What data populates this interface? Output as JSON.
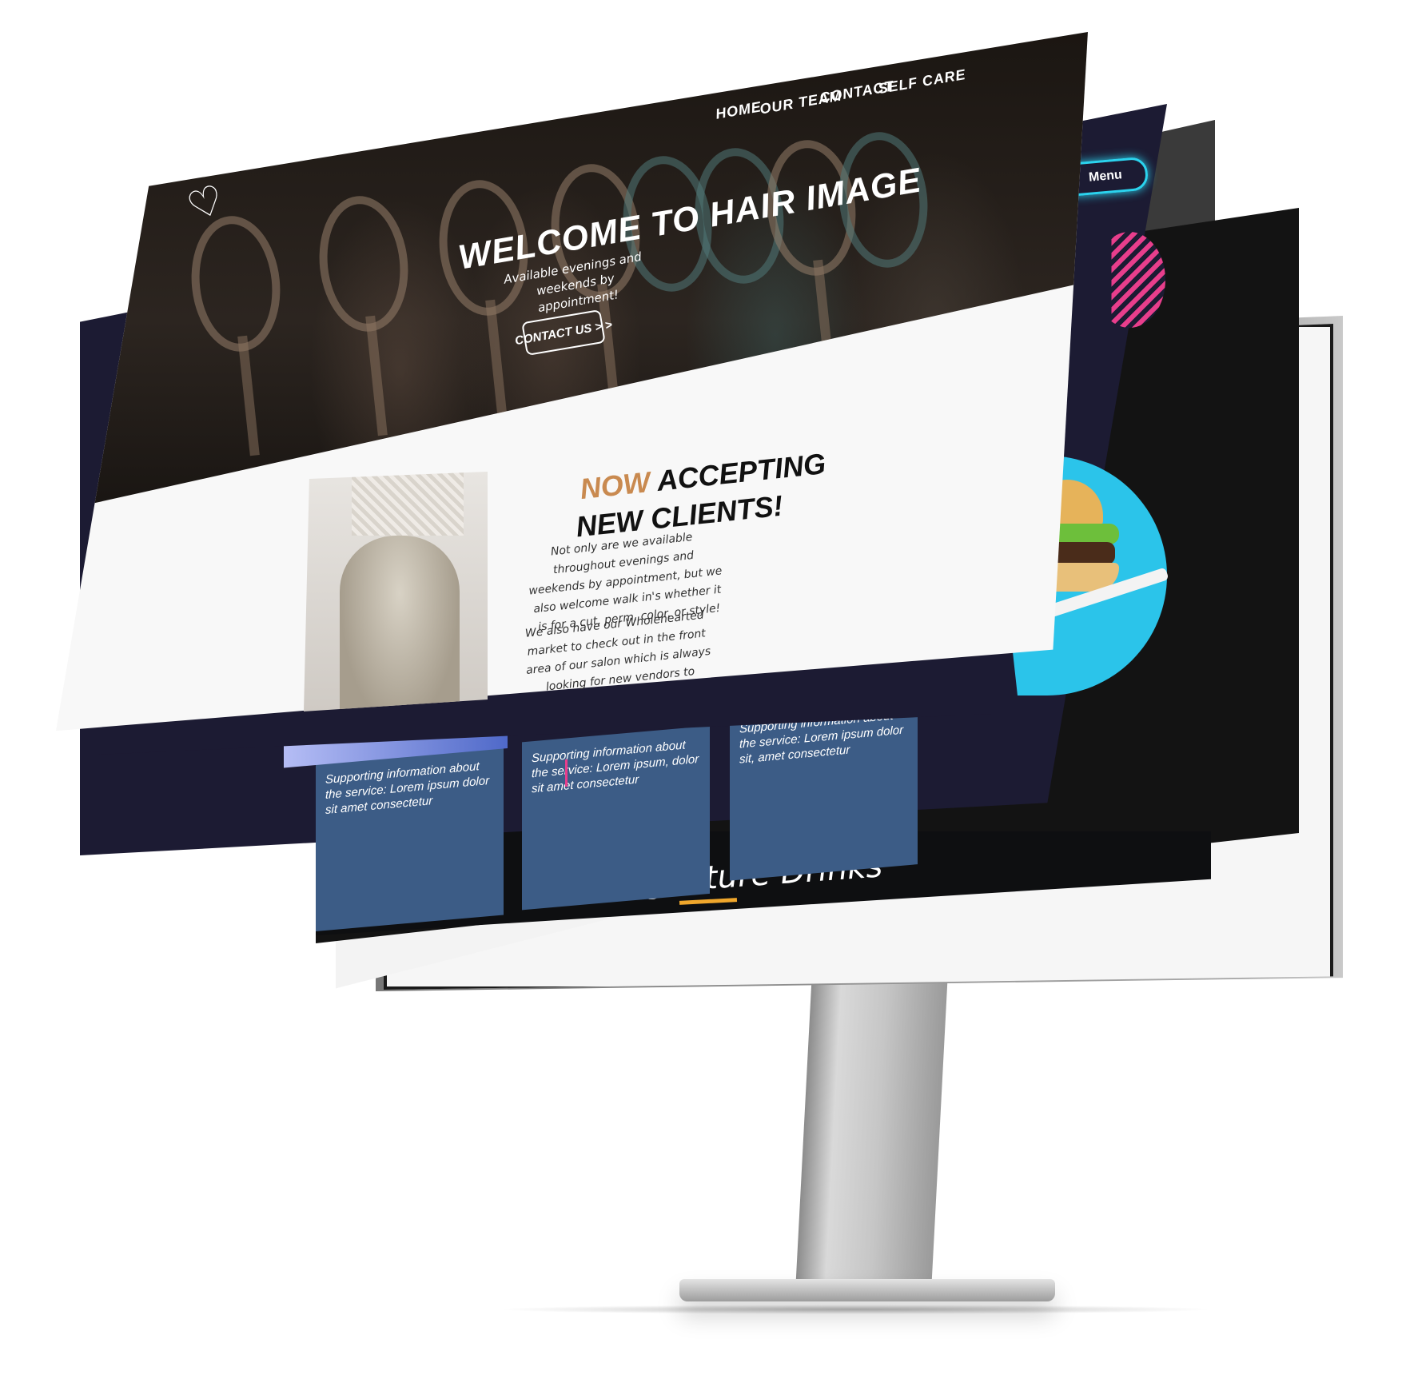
{
  "hair_site": {
    "nav": [
      "HOME",
      "OUR TEAM",
      "CONTACT",
      "SELF CARE"
    ],
    "logo_icon": "heart-arrow-icon",
    "hero_title": "WELCOME TO HAIR IMAGE",
    "hero_subtitle": "Available evenings and weekends by appointment!",
    "cta_label": "CONTACT US > >",
    "accept_accent": "NOW",
    "accept_rest": " ACCEPTING",
    "accept_line2": "NEW CLIENTS!",
    "paragraph1": "Not only are we available throughout evenings and weekends by appointment, but we also welcome walk in's whether it is for a cut, perm, color, or style!",
    "paragraph2": "We also have our Wholehearted market to check out in the front area of our salon which is always looking for new vendors to"
  },
  "restaurant_site": {
    "menu_button": "Menu",
    "cards": [
      "Supporting information about the service: Lorem ipsum dolor sit amet consectetur",
      "Supporting information about the service: Lorem ipsum, dolor sit amet consectetur",
      "Supporting information about the service: Lorem ipsum dolor sit, amet consectetur"
    ]
  },
  "drinks_site": {
    "title": "Signature Drinks"
  },
  "colors": {
    "accent_orange": "#c98a50",
    "navy": "#1c1b33",
    "cyan": "#2bc4ea",
    "pink": "#e83e8c",
    "gold": "#f0a72c"
  }
}
